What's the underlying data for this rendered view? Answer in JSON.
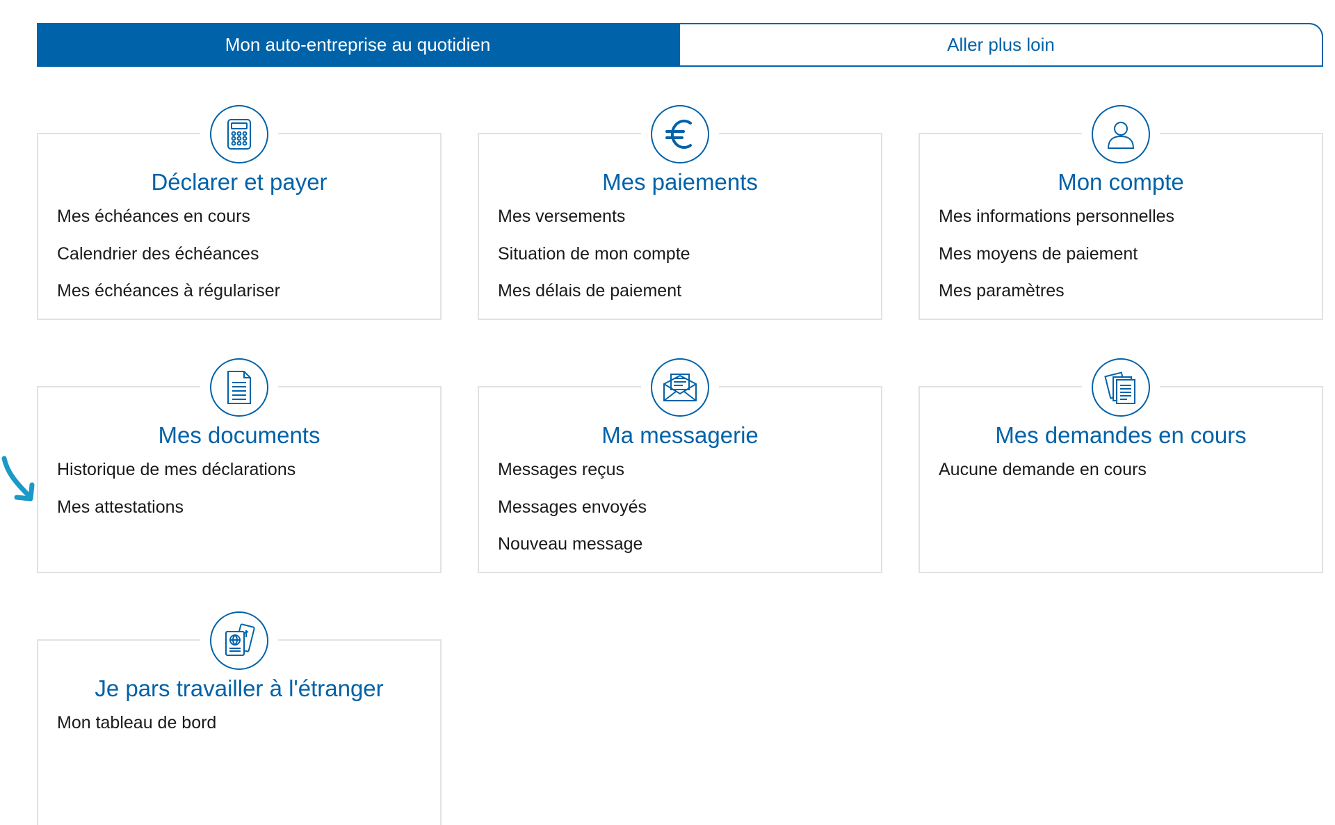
{
  "tabs": [
    {
      "label": "Mon auto-entreprise au quotidien",
      "active": true
    },
    {
      "label": "Aller plus loin",
      "active": false
    }
  ],
  "cards": [
    {
      "title": "Déclarer et payer",
      "icon": "calculator-icon",
      "links": [
        "Mes échéances en cours",
        "Calendrier des échéances",
        "Mes échéances à régulariser"
      ]
    },
    {
      "title": "Mes paiements",
      "icon": "euro-icon",
      "links": [
        "Mes versements",
        "Situation de mon compte",
        "Mes délais de paiement"
      ]
    },
    {
      "title": "Mon compte",
      "icon": "user-icon",
      "links": [
        "Mes informations personnelles",
        "Mes moyens de paiement",
        "Mes paramètres"
      ]
    },
    {
      "title": "Mes documents",
      "icon": "document-icon",
      "links": [
        "Historique de mes déclarations",
        "Mes attestations"
      ]
    },
    {
      "title": "Ma messagerie",
      "icon": "envelope-icon",
      "links": [
        "Messages reçus",
        "Messages envoyés",
        "Nouveau message"
      ]
    },
    {
      "title": "Mes demandes en cours",
      "icon": "documents-stack-icon",
      "links": [
        "Aucune demande en cours"
      ]
    },
    {
      "title": "Je pars travailler à l'étranger",
      "icon": "passport-icon",
      "links": [
        "Mon tableau de bord"
      ]
    }
  ],
  "colors": {
    "primary": "#0062a8",
    "arrow": "#1b9ac8",
    "border": "#e2e2e2"
  }
}
